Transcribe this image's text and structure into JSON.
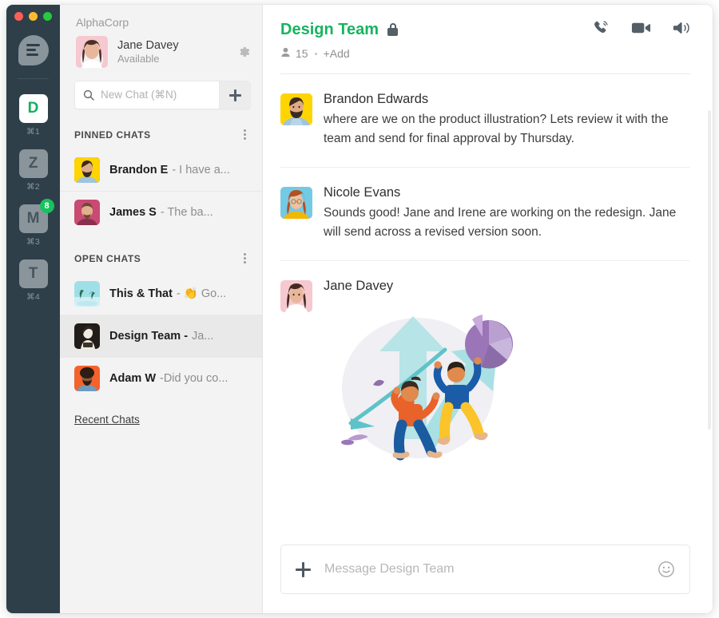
{
  "window": {
    "traffic_lights": [
      "close",
      "minimize",
      "maximize"
    ],
    "app_logo": "chat-bubble-logo"
  },
  "rail": {
    "workspaces": [
      {
        "letter": "D",
        "shortcut": "⌘1",
        "active": true,
        "badge": ""
      },
      {
        "letter": "Z",
        "shortcut": "⌘2",
        "active": false,
        "badge": ""
      },
      {
        "letter": "M",
        "shortcut": "⌘3",
        "active": false,
        "badge": "8"
      },
      {
        "letter": "T",
        "shortcut": "⌘4",
        "active": false,
        "badge": ""
      }
    ]
  },
  "sidebar": {
    "org_name": "AlphaCorp",
    "user": {
      "name": "Jane Davey",
      "status": "Available"
    },
    "settings_icon": "gear-icon",
    "search": {
      "placeholder": "New Chat (⌘N)",
      "icon": "search-icon",
      "add_button": "new-chat-plus"
    },
    "sections": [
      {
        "title": "PINNED CHATS",
        "menu_icon": "kebab-menu",
        "chats": [
          {
            "name": "Brandon E",
            "preview": "- I have a...",
            "selected": false,
            "avatar": "brandon"
          },
          {
            "name": "James S",
            "preview": "- The ba...",
            "selected": false,
            "avatar": "james"
          }
        ]
      },
      {
        "title": "OPEN CHATS",
        "menu_icon": "kebab-menu",
        "chats": [
          {
            "name": "This & That",
            "preview": "- 👏 Go...",
            "selected": false,
            "avatar": "palm"
          },
          {
            "name": "Design Team -",
            "preview": "Ja...",
            "selected": true,
            "avatar": "design"
          },
          {
            "name": "Adam W",
            "preview": "-Did you co...",
            "selected": false,
            "avatar": "adam"
          }
        ]
      }
    ],
    "recent_chats_link": "Recent Chats"
  },
  "conversation": {
    "title": "Design Team",
    "locked_icon": "lock-icon",
    "member_count": "15",
    "add_label": "+Add",
    "actions": [
      {
        "name": "phone-call-icon"
      },
      {
        "name": "video-call-icon"
      },
      {
        "name": "speaker-icon"
      }
    ],
    "messages": [
      {
        "author": "Brandon Edwards",
        "avatar": "brandon",
        "text": "where are we on the product illustration? Lets review it with the team and send for final approval by Thursday."
      },
      {
        "author": "Nicole Evans",
        "avatar": "nicole",
        "text": "Sounds good! Jane and Irene are working on the redesign. Jane will send across a revised version soon."
      },
      {
        "author": "Jane Davey",
        "avatar": "jane",
        "text": "",
        "attachment": "growth-chart-illustration"
      }
    ],
    "composer": {
      "placeholder": "Message Design Team",
      "attach_icon": "plus-icon",
      "emoji_icon": "smiley-icon"
    }
  },
  "colors": {
    "rail_bg": "#2e3f49",
    "accent_green": "#16b45f",
    "badge_green": "#19c15e",
    "list_bg": "#f3f3f3",
    "selected_row": "#e9e9e9"
  }
}
